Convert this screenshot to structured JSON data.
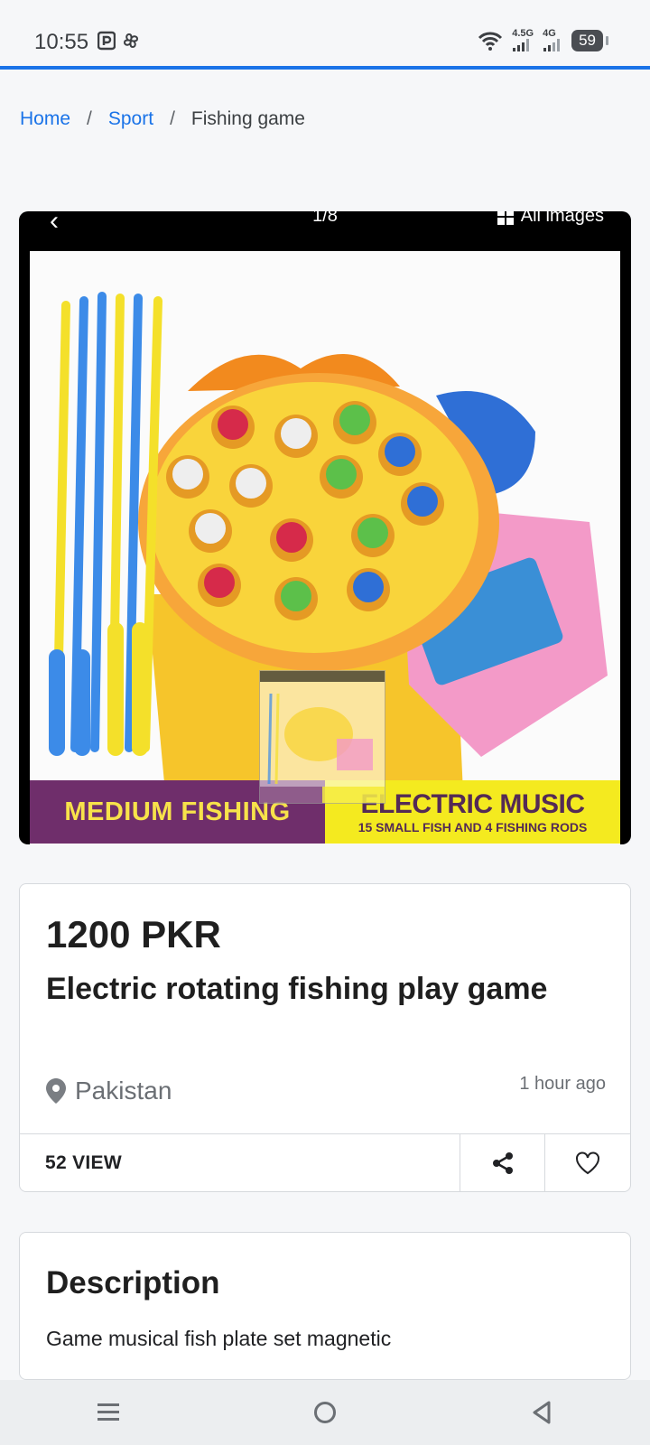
{
  "status_bar": {
    "time": "10:55",
    "net_1": "4.5G",
    "net_2": "4G",
    "battery": "59"
  },
  "breadcrumb": {
    "home": "Home",
    "category": "Sport",
    "current": "Fishing game",
    "separator": "/"
  },
  "gallery": {
    "back_symbol": "‹",
    "counter": "1/8",
    "all_images_label": "All images",
    "banner_left": "MEDIUM FISHING",
    "banner_right_main": "ELECTRIC MUSIC",
    "banner_right_sub": "15 SMALL FISH AND 4 FISHING RODS"
  },
  "listing": {
    "price": "1200 PKR",
    "title": "Electric rotating fishing play game",
    "location": "Pakistan",
    "posted": "1 hour ago",
    "views": "52 VIEW"
  },
  "description": {
    "heading": "Description",
    "text": "Game musical fish plate set magnetic"
  },
  "colors": {
    "accent": "#1a73e8",
    "banner_purple": "#6f2e6b",
    "banner_yellow": "#f4ea1f"
  }
}
